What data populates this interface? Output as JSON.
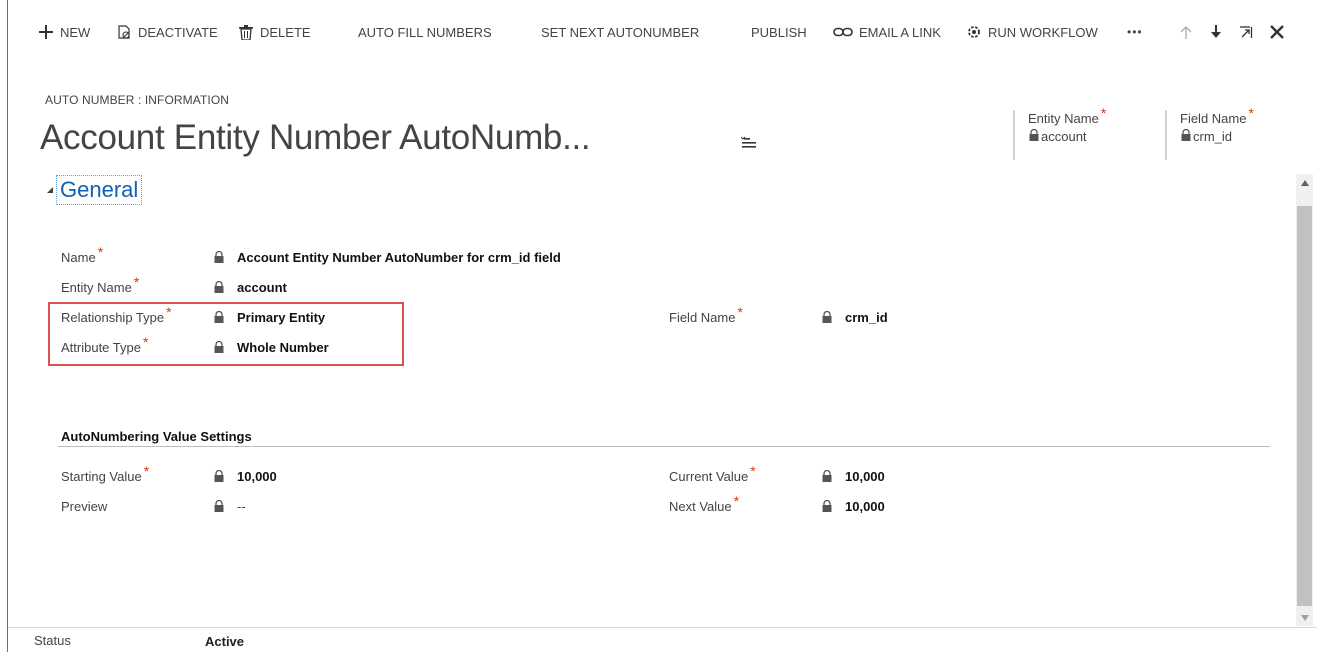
{
  "toolbar": {
    "new_label": "NEW",
    "deactivate_label": "DEACTIVATE",
    "delete_label": "DELETE",
    "auto_fill_label": "AUTO FILL NUMBERS",
    "set_next_label": "SET NEXT AUTONUMBER",
    "publish_label": "PUBLISH",
    "email_link_label": "EMAIL A LINK",
    "run_workflow_label": "RUN WORKFLOW",
    "more_label": "•••"
  },
  "header": {
    "breadcrumb": "AUTO NUMBER : INFORMATION",
    "title": "Account Entity Number AutoNumb...",
    "fields": [
      {
        "label": "Entity Name",
        "value": "account"
      },
      {
        "label": "Field Name",
        "value": "crm_id"
      }
    ]
  },
  "general": {
    "section_title": "General",
    "name": {
      "label": "Name",
      "value": "Account Entity Number AutoNumber for crm_id field"
    },
    "entity_name": {
      "label": "Entity Name",
      "value": "account"
    },
    "relationship_type": {
      "label": "Relationship Type",
      "value": "Primary Entity"
    },
    "attribute_type": {
      "label": "Attribute Type",
      "value": "Whole Number"
    },
    "field_name": {
      "label": "Field Name",
      "value": "crm_id"
    }
  },
  "autonumbering": {
    "heading": "AutoNumbering Value Settings",
    "starting_value": {
      "label": "Starting Value",
      "value": "10,000"
    },
    "preview": {
      "label": "Preview",
      "value": "--"
    },
    "current_value": {
      "label": "Current Value",
      "value": "10,000"
    },
    "next_value": {
      "label": "Next Value",
      "value": "10,000"
    }
  },
  "footer": {
    "status_label": "Status",
    "status_value": "Active"
  },
  "required_marker": "*",
  "colors": {
    "accent": "#1160b7",
    "required": "#d83b01",
    "highlight": "#d9534f"
  }
}
